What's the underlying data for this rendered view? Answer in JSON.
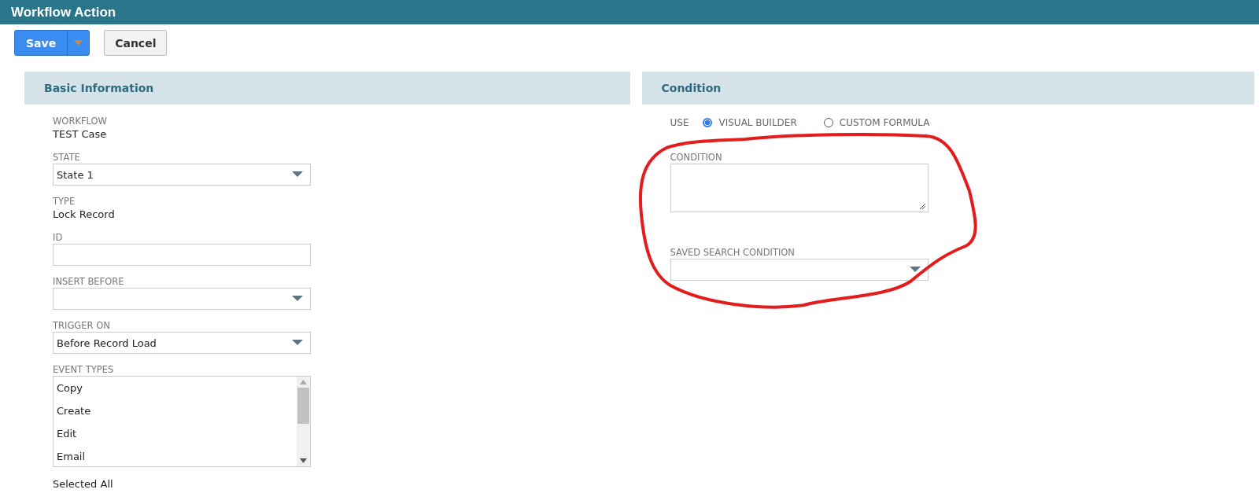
{
  "window": {
    "title": "Workflow Action"
  },
  "toolbar": {
    "buttons": [
      {
        "kind": "primary",
        "label": "Save",
        "has_menu": true
      },
      {
        "kind": "secondary",
        "label": "Cancel",
        "has_menu": false
      }
    ]
  },
  "basic_information": {
    "title": "Basic Information",
    "fields": [
      {
        "kind": "text",
        "label": "WORKFLOW",
        "value": "TEST Case"
      },
      {
        "kind": "select",
        "label": "STATE",
        "value": "State 1"
      },
      {
        "kind": "text",
        "label": "TYPE",
        "value": "Lock Record"
      },
      {
        "kind": "input",
        "label": "ID"
      },
      {
        "kind": "select",
        "label": "INSERT BEFORE"
      },
      {
        "kind": "select",
        "label": "TRIGGER ON",
        "value": "Before Record Load"
      },
      {
        "kind": "listbox",
        "label": "EVENT TYPES",
        "items": [
          "Copy",
          "Create",
          "Edit",
          "Email"
        ]
      },
      {
        "kind": "note",
        "value": "Selected All"
      }
    ]
  },
  "condition": {
    "title": "Condition",
    "use": {
      "label": "USE",
      "options": [
        {
          "label": "VISUAL BUILDER",
          "selected": true
        },
        {
          "label": "CUSTOM FORMULA",
          "selected": false
        }
      ]
    },
    "fields": [
      {
        "kind": "textarea",
        "label": "CONDITION"
      },
      {
        "kind": "select",
        "label": "SAVED SEARCH CONDITION"
      }
    ],
    "highlight": {
      "kind": "freehand-loop"
    }
  }
}
